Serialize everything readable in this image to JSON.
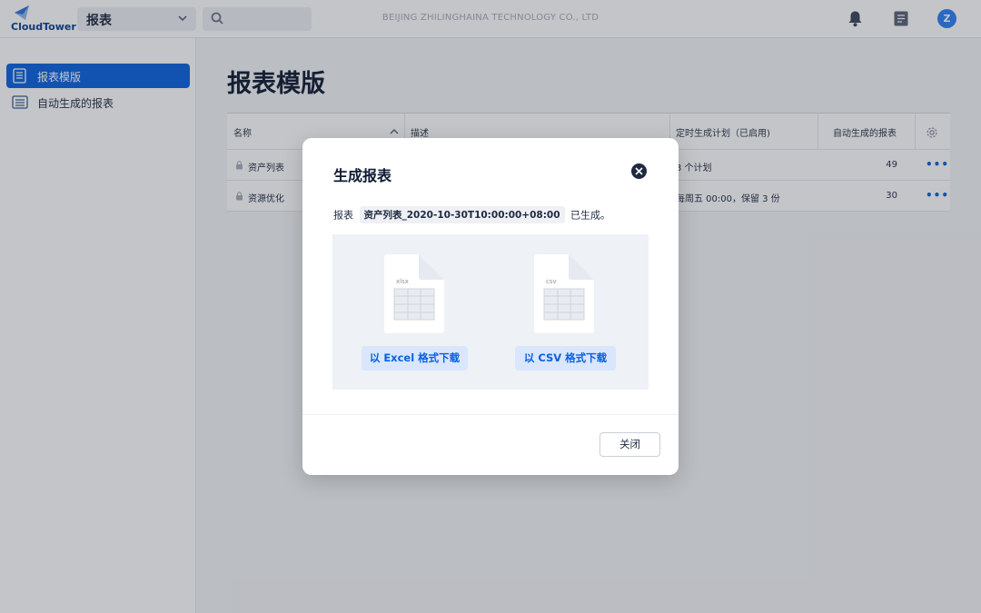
{
  "app": {
    "logo_text": "CloudTower",
    "module": "报表",
    "company": "BEIJING ZHILINGHAINA TECHNOLOGY CO., LTD",
    "avatar_letter": "Z",
    "accent_color": "#0a61e0"
  },
  "sidebar": {
    "items": [
      {
        "label": "报表模版",
        "icon": "report-template-icon",
        "active": true
      },
      {
        "label": "自动生成的报表",
        "icon": "auto-report-icon",
        "active": false
      }
    ]
  },
  "main": {
    "title": "报表模版",
    "table": {
      "headers": [
        "名称",
        "描述",
        "定时生成计划（已启用)",
        "自动生成的报表"
      ],
      "rows": [
        {
          "name": "资产列表",
          "schedule": "3 个计划",
          "count": "49"
        },
        {
          "name": "资源优化",
          "schedule": "每周五 00:00，保留 3 份",
          "count": "30"
        }
      ]
    }
  },
  "modal": {
    "title": "生成报表",
    "desc_prefix": "报表",
    "file_name": "资产列表_2020-10-30T10:00:00+08:00",
    "desc_suffix": "已生成。",
    "excel_type": "xlsx",
    "csv_type": "csv",
    "excel_button": "以 Excel 格式下载",
    "csv_button": "以 CSV 格式下载",
    "close_button": "关闭"
  }
}
